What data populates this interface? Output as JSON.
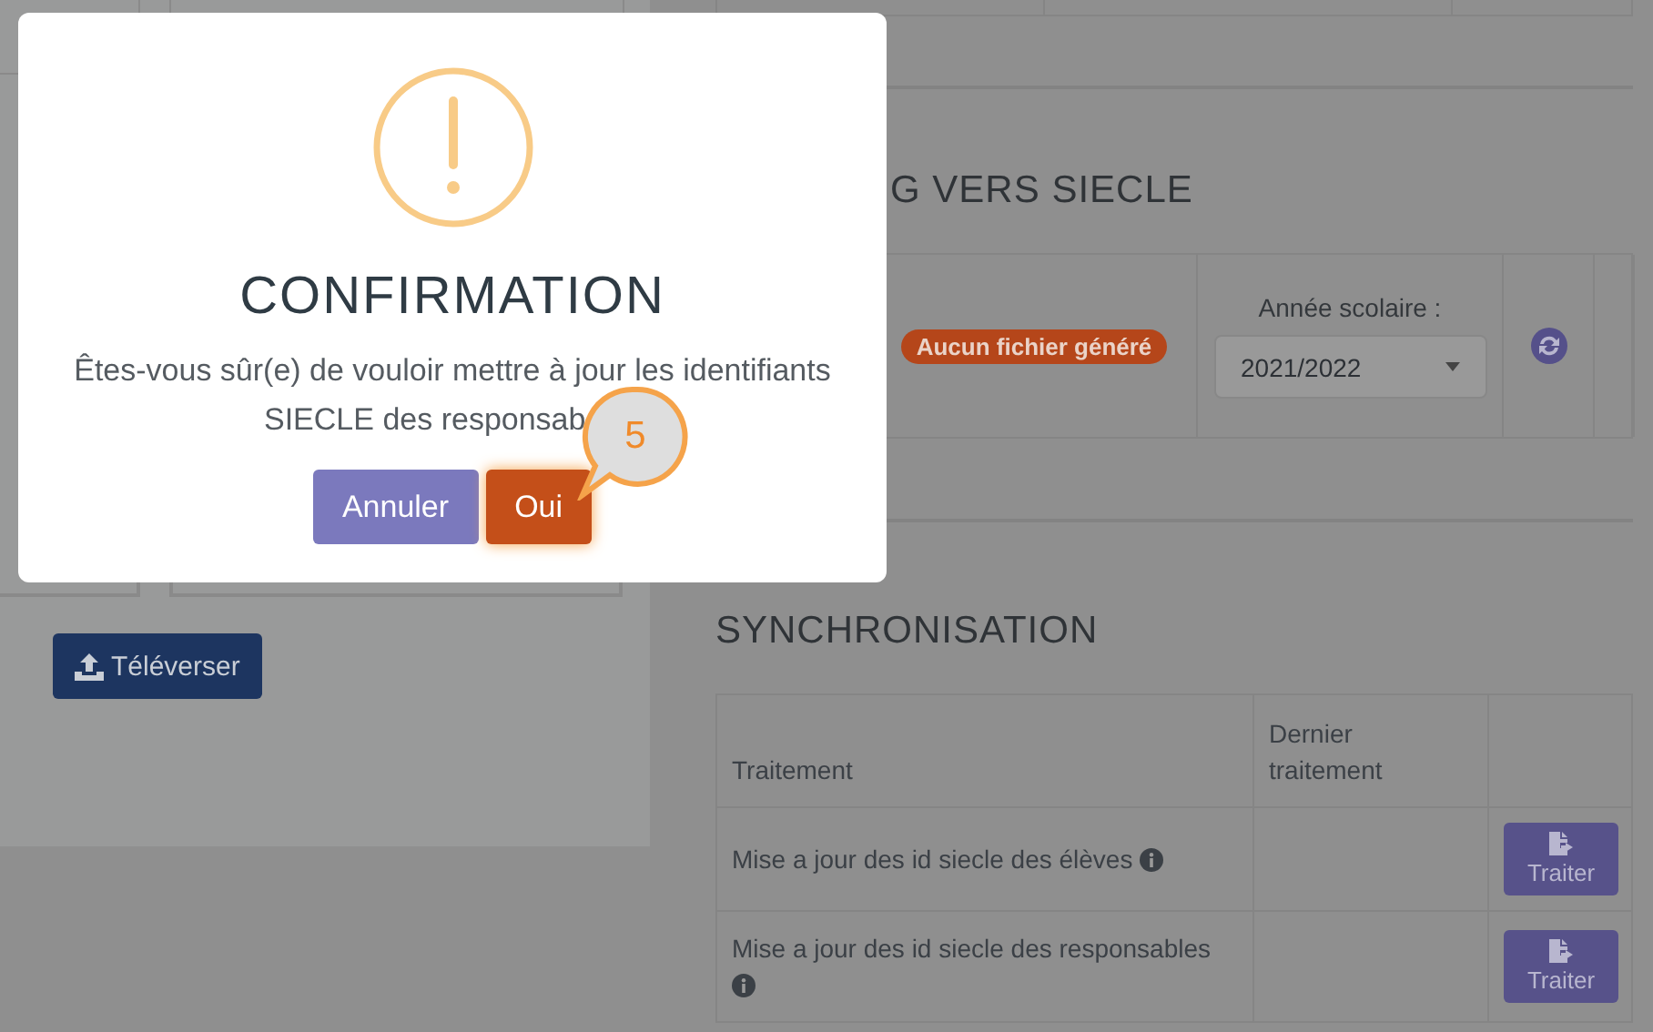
{
  "left_panel": {
    "upload_button": "Téléverser"
  },
  "export_section": {
    "title": "G VERS SIECLE",
    "status_badge": "Aucun fichier généré",
    "year_label": "Année scolaire :",
    "year_select": "2021/2022"
  },
  "sync_section": {
    "title": "SYNCHRONISATION",
    "columns": [
      "Traitement",
      "Dernier traitement"
    ],
    "rows": [
      {
        "label": "Mise a jour des id siecle des élèves",
        "button": "Traiter"
      },
      {
        "label": "Mise a jour des id siecle des responsables",
        "button": "Traiter"
      }
    ]
  },
  "dialog": {
    "title": "CONFIRMATION",
    "message_lines": [
      "Êtes-vous sûr(e) de vouloir mettre à jour les identifiants",
      "SIECLE des responsab"
    ],
    "buttons": [
      {
        "label": "Annuler",
        "kind": "cancel"
      },
      {
        "label": "Oui",
        "kind": "confirm"
      }
    ]
  },
  "callout": {
    "label": "5"
  }
}
